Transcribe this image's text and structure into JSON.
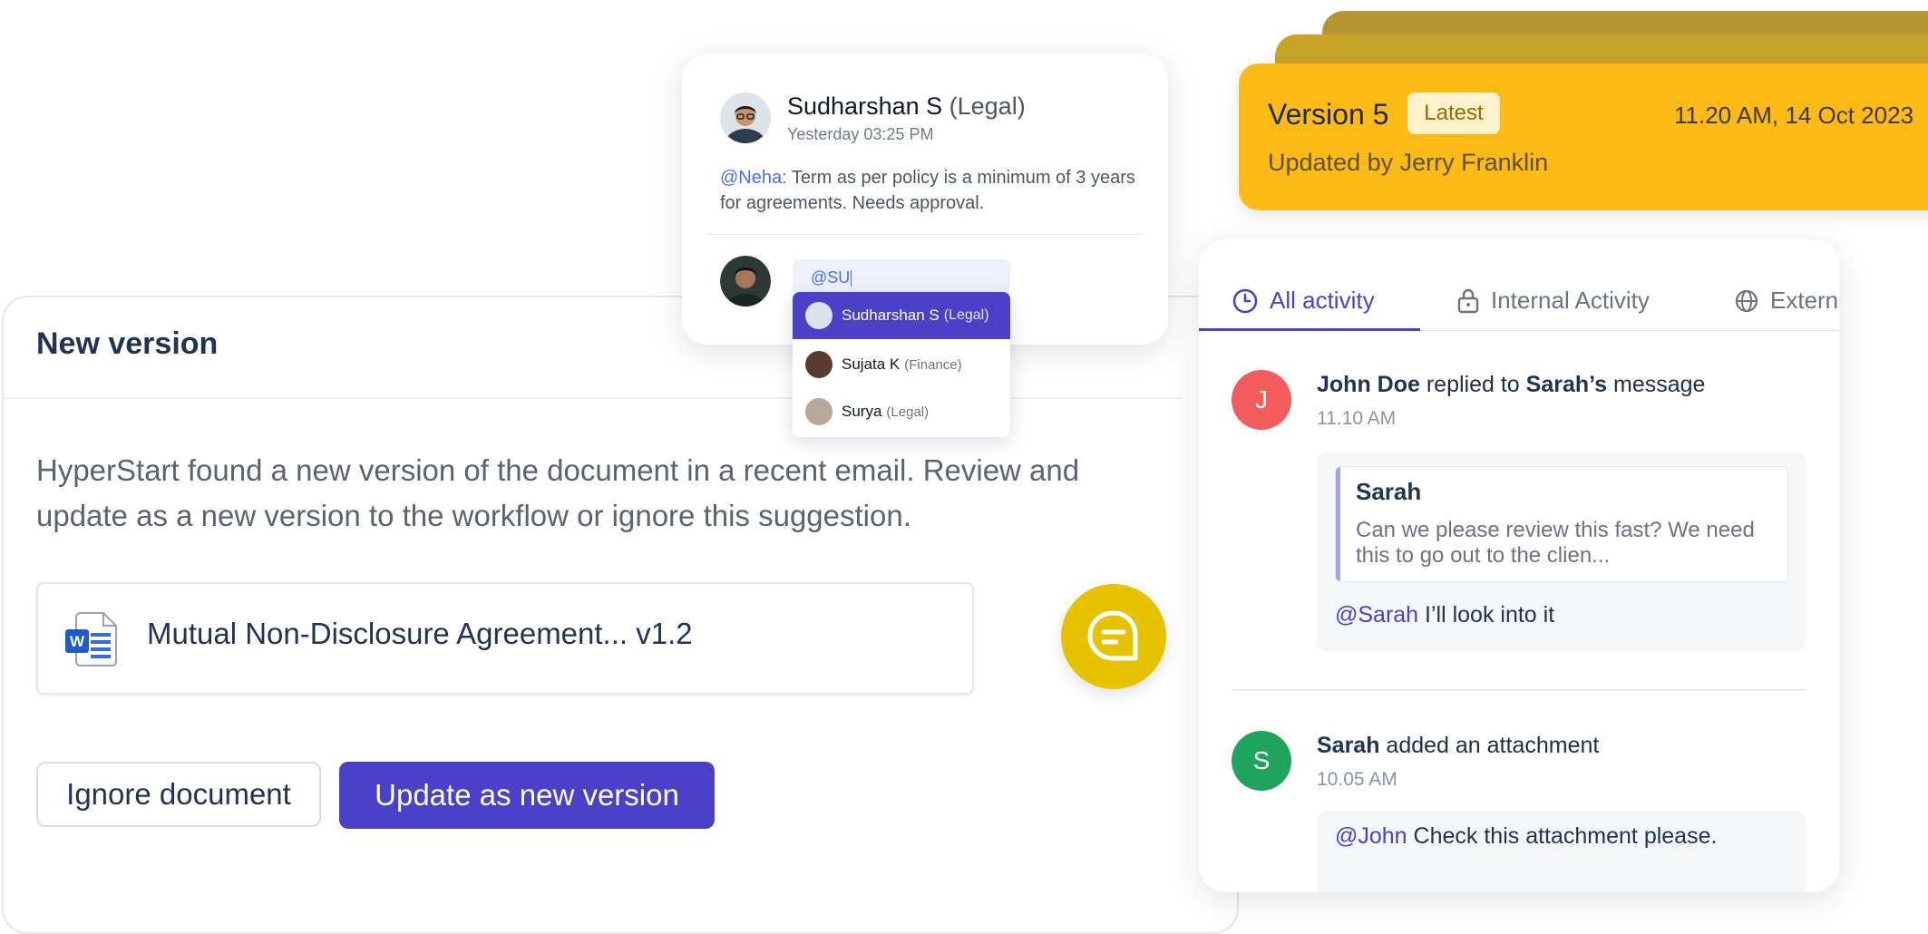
{
  "new_version": {
    "title": "New version",
    "description": "HyperStart found a new version of the document in a recent email. Review and update as a new version to the workflow or ignore this suggestion.",
    "document_name": "Mutual Non-Disclosure Agreement... v1.2",
    "document_icon": "word-doc-icon",
    "ignore_label": "Ignore document",
    "update_label": "Update as new version"
  },
  "comment": {
    "author": "Sudharshan S",
    "author_dept": "(Legal)",
    "time": "Yesterday 03:25 PM",
    "mention": "@Neha:",
    "message": " Term as per policy is a minimum of 3 years for agreements. Needs approval.",
    "input_value": "@SU",
    "suggestions": [
      {
        "name": "Sudharshan S",
        "dept": "(Legal)"
      },
      {
        "name": "Sujata K",
        "dept": "(Finance)"
      },
      {
        "name": "Surya",
        "dept": "(Legal)"
      }
    ]
  },
  "version": {
    "title": "Version 5",
    "badge": "Latest",
    "date": "11.20 AM, 14 Oct 2023",
    "updated_by": "Updated by Jerry Franklin"
  },
  "activity": {
    "tabs": [
      {
        "label": "All activity",
        "icon": "clock-icon"
      },
      {
        "label": "Internal Activity",
        "icon": "lock-icon"
      },
      {
        "label": "External",
        "icon": "globe-icon"
      }
    ],
    "items": [
      {
        "initial": "J",
        "color": "#f25c5c",
        "actor": "John Doe",
        "action": " replied to ",
        "target": "Sarah’s",
        "rest": " message",
        "time": "11.10 AM",
        "quote_author": "Sarah",
        "quote_text": "Can we please review this fast? We need this to go out to the clien...",
        "reply_mention": "@Sarah",
        "reply_text": " I’ll look into it"
      },
      {
        "initial": "S",
        "color": "#1fa45e",
        "actor": "Sarah",
        "action": " added an attachment",
        "time": "10.05 AM",
        "reply_mention": "@John",
        "reply_text": " Check this attachment please."
      }
    ]
  },
  "colors": {
    "primary": "#4a41c8",
    "version_card": "#fbba16",
    "fab": "#e7c200"
  }
}
